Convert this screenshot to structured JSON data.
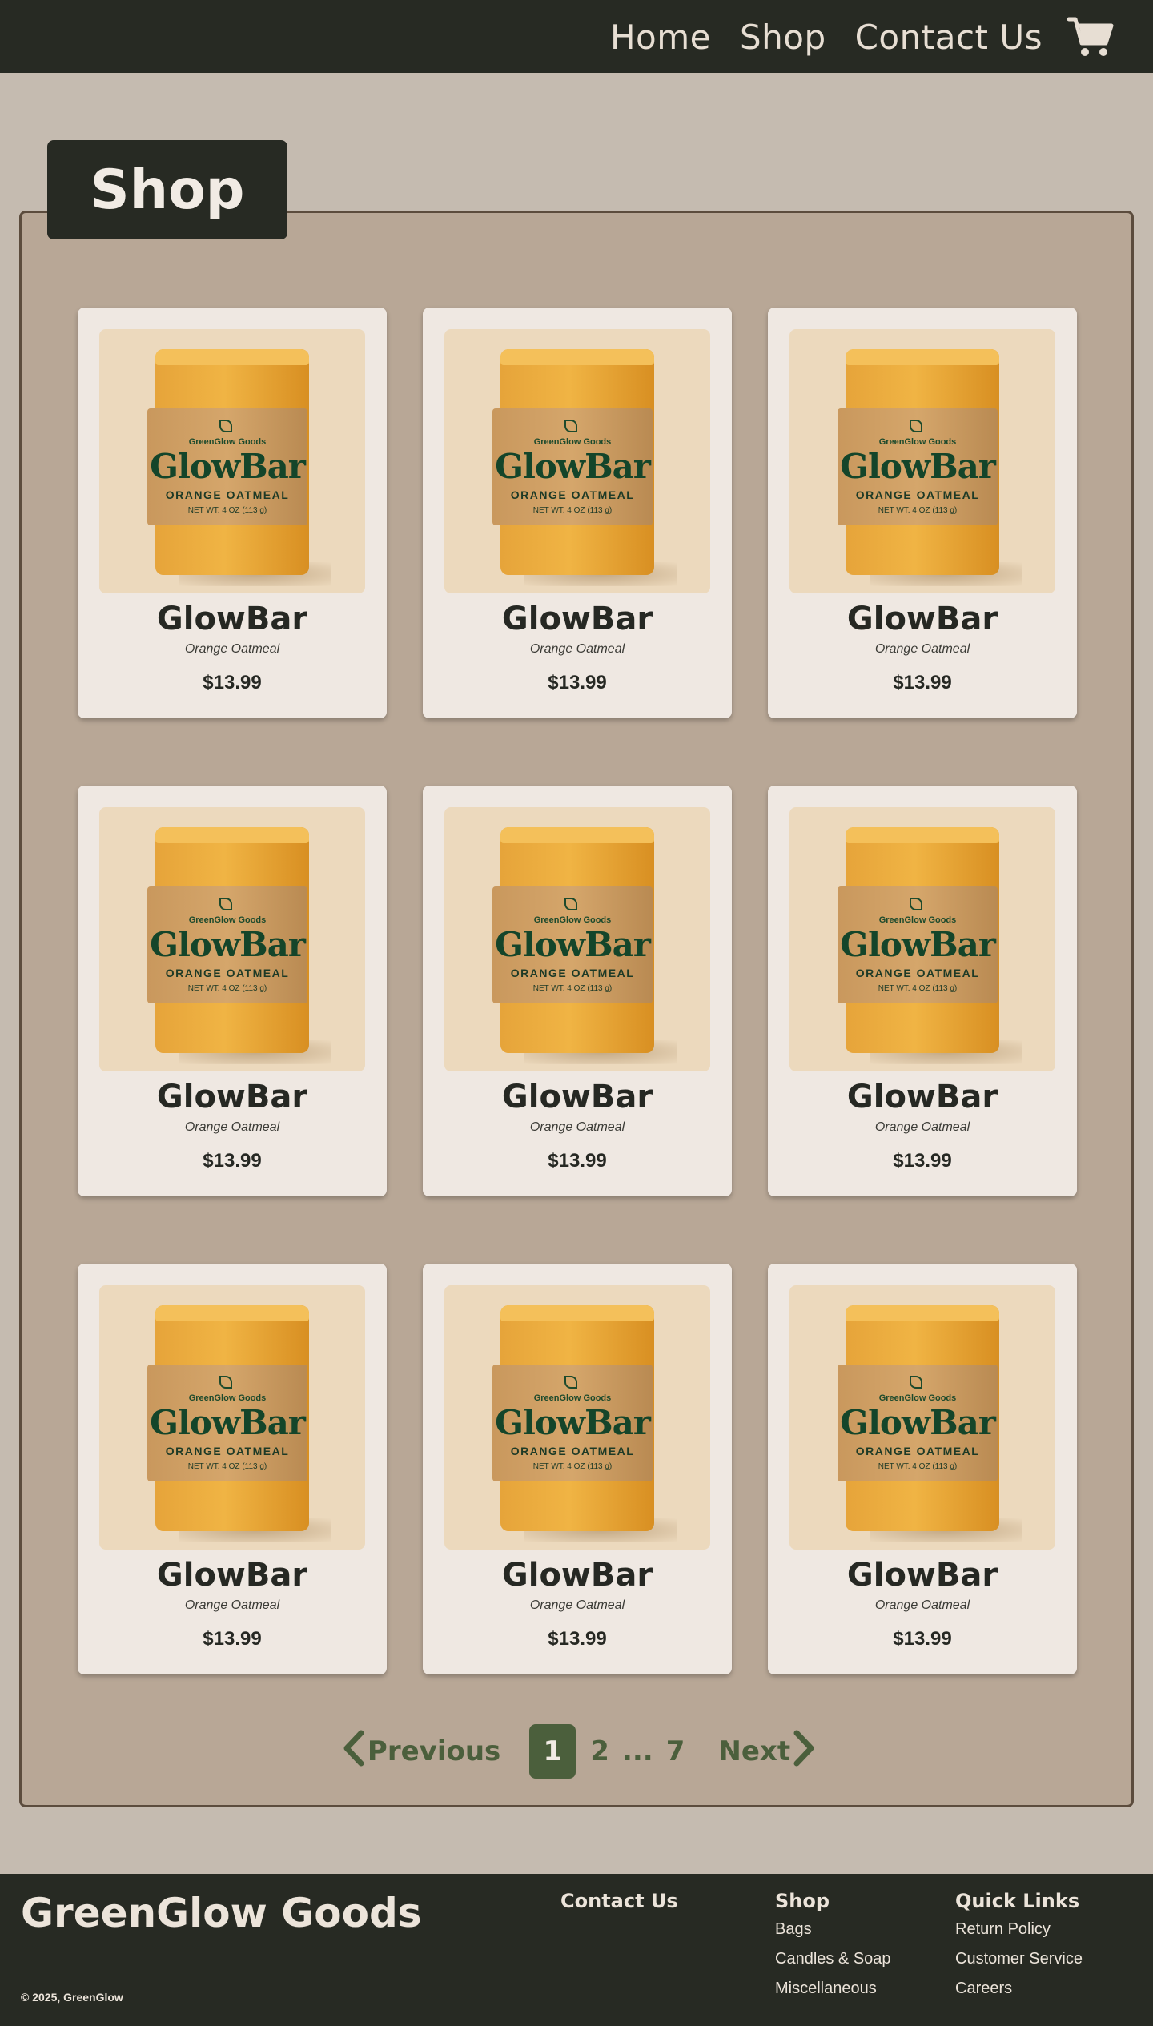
{
  "header": {
    "nav": [
      "Home",
      "Shop",
      "Contact Us"
    ],
    "cart_icon": "cart-icon"
  },
  "page_title": "Shop",
  "products": [
    {
      "name": "GlowBar",
      "variant": "Orange Oatmeal",
      "price": "$13.99",
      "label": {
        "brand": "GreenGlow Goods",
        "title": "GlowBar",
        "scent": "ORANGE OATMEAL",
        "weight": "NET WT. 4 OZ (113 g)"
      }
    },
    {
      "name": "GlowBar",
      "variant": "Orange Oatmeal",
      "price": "$13.99",
      "label": {
        "brand": "GreenGlow Goods",
        "title": "GlowBar",
        "scent": "ORANGE OATMEAL",
        "weight": "NET WT. 4 OZ (113 g)"
      }
    },
    {
      "name": "GlowBar",
      "variant": "Orange Oatmeal",
      "price": "$13.99",
      "label": {
        "brand": "GreenGlow Goods",
        "title": "GlowBar",
        "scent": "ORANGE OATMEAL",
        "weight": "NET WT. 4 OZ (113 g)"
      }
    },
    {
      "name": "GlowBar",
      "variant": "Orange Oatmeal",
      "price": "$13.99",
      "label": {
        "brand": "GreenGlow Goods",
        "title": "GlowBar",
        "scent": "ORANGE OATMEAL",
        "weight": "NET WT. 4 OZ (113 g)"
      }
    },
    {
      "name": "GlowBar",
      "variant": "Orange Oatmeal",
      "price": "$13.99",
      "label": {
        "brand": "GreenGlow Goods",
        "title": "GlowBar",
        "scent": "ORANGE OATMEAL",
        "weight": "NET WT. 4 OZ (113 g)"
      }
    },
    {
      "name": "GlowBar",
      "variant": "Orange Oatmeal",
      "price": "$13.99",
      "label": {
        "brand": "GreenGlow Goods",
        "title": "GlowBar",
        "scent": "ORANGE OATMEAL",
        "weight": "NET WT. 4 OZ (113 g)"
      }
    },
    {
      "name": "GlowBar",
      "variant": "Orange Oatmeal",
      "price": "$13.99",
      "label": {
        "brand": "GreenGlow Goods",
        "title": "GlowBar",
        "scent": "ORANGE OATMEAL",
        "weight": "NET WT. 4 OZ (113 g)"
      }
    },
    {
      "name": "GlowBar",
      "variant": "Orange Oatmeal",
      "price": "$13.99",
      "label": {
        "brand": "GreenGlow Goods",
        "title": "GlowBar",
        "scent": "ORANGE OATMEAL",
        "weight": "NET WT. 4 OZ (113 g)"
      }
    },
    {
      "name": "GlowBar",
      "variant": "Orange Oatmeal",
      "price": "$13.99",
      "label": {
        "brand": "GreenGlow Goods",
        "title": "GlowBar",
        "scent": "ORANGE OATMEAL",
        "weight": "NET WT. 4 OZ (113 g)"
      }
    }
  ],
  "pagination": {
    "previous_label": "Previous",
    "next_label": "Next",
    "current_page": "1",
    "pages": [
      "2",
      "...",
      "7"
    ]
  },
  "footer": {
    "brand": "GreenGlow Goods",
    "copyright": "© 2025, GreenGlow",
    "contact_heading": "Contact Us",
    "shop_heading": "Shop",
    "shop_links": [
      "Bags",
      "Candles & Soap",
      "Miscellaneous"
    ],
    "quick_heading": "Quick Links",
    "quick_links": [
      "Return Policy",
      "Customer Service",
      "Careers"
    ]
  },
  "colors": {
    "dark": "#272a23",
    "page_bg": "#c5bbb0",
    "panel_bg": "#b8a796",
    "card_bg": "#efe8e2",
    "accent_green": "#4b5f3c",
    "soap_orange": "#f0b444"
  }
}
